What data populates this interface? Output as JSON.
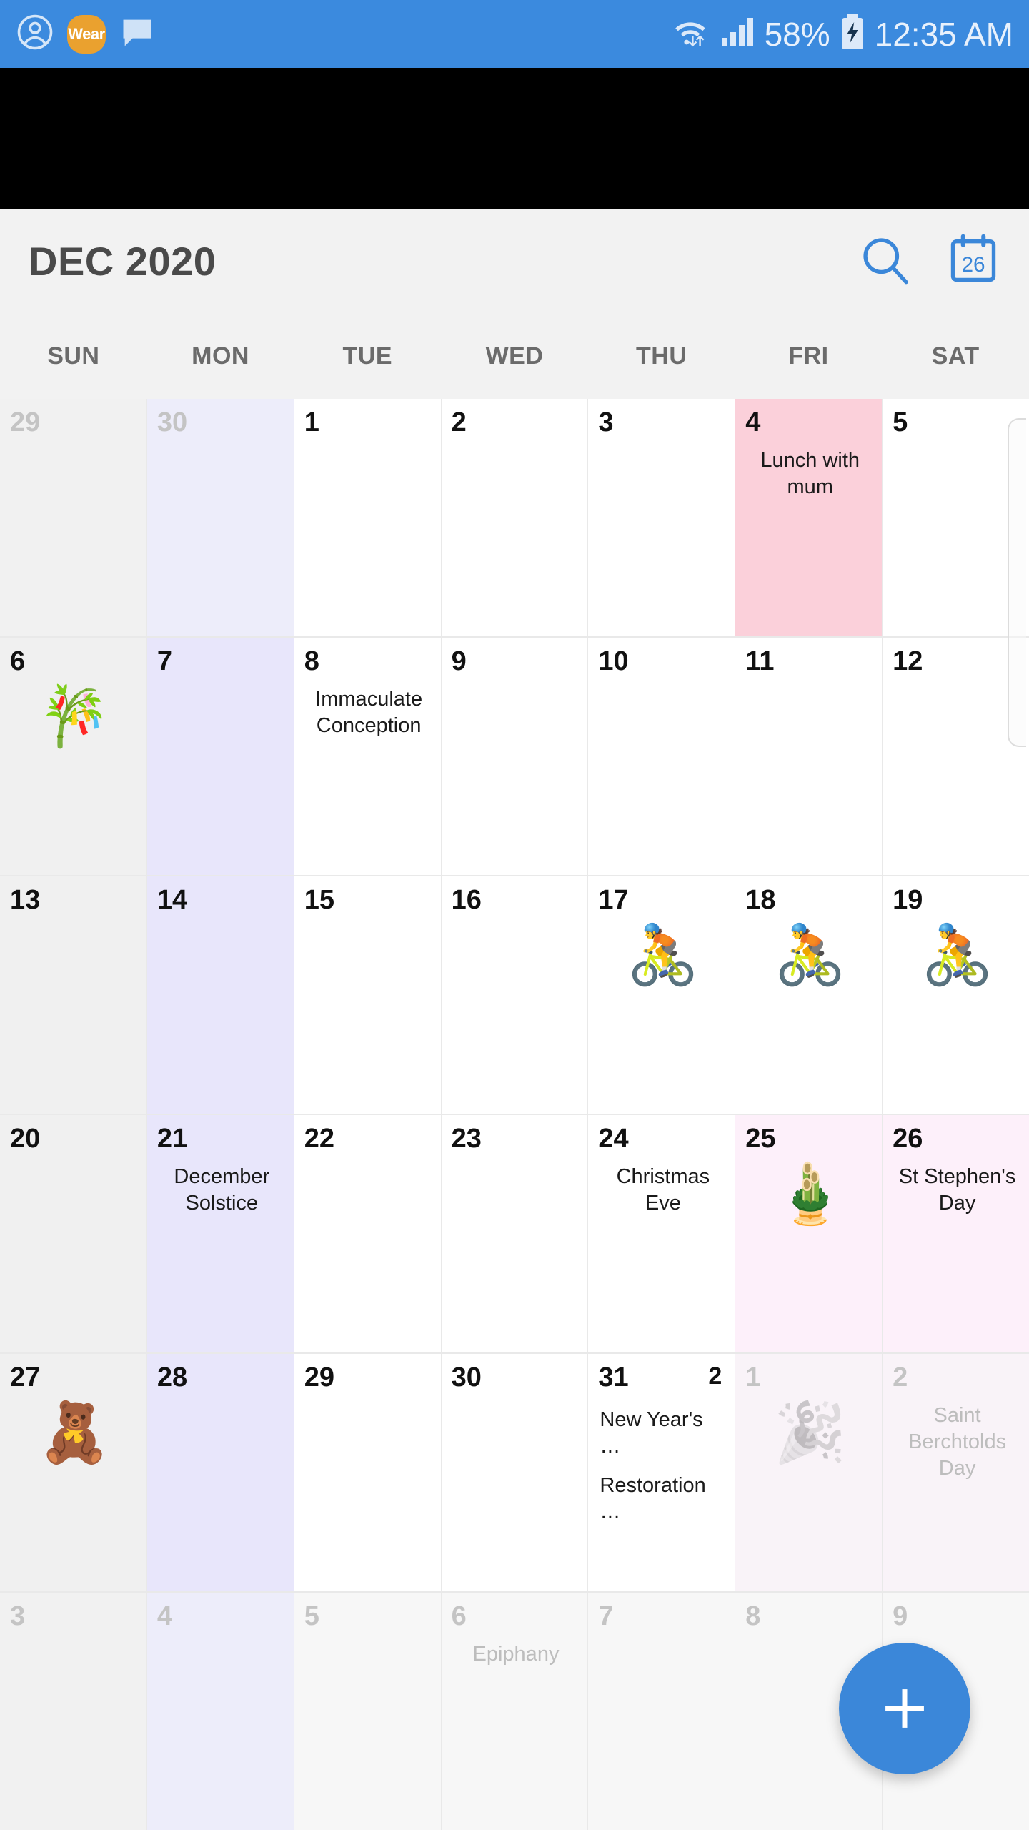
{
  "status_bar": {
    "background": "#3b8ade",
    "left_icons": [
      {
        "name": "account-icon",
        "label": "account"
      },
      {
        "name": "wear-badge-icon",
        "label": "Wear"
      },
      {
        "name": "message-bubble-icon",
        "label": "message"
      }
    ],
    "wear_label": "Wear",
    "wifi_icon": "wifi-icon",
    "signal_icon": "signal-bars-icon",
    "battery_percent": "58%",
    "battery_icon": "battery-charging-icon",
    "time": "12:35 AM"
  },
  "header": {
    "title": "DEC 2020",
    "search_icon": "search-icon",
    "today_icon": "calendar-today-icon",
    "today_icon_number": "26",
    "accent": "#3b87d9"
  },
  "weekdays": [
    "SUN",
    "MON",
    "TUE",
    "WED",
    "THU",
    "FRI",
    "SAT"
  ],
  "colors": {
    "sunday_bg": "#f0f0f0",
    "monday_bg": "#e8e6fb",
    "event_pink": "#fbd0da",
    "holiday_pink": "#fdf0fa",
    "out_of_month_text": "#c4c4c4",
    "fab_blue": "#3b87d9"
  },
  "fab": {
    "label": "+",
    "name": "add-event-button"
  },
  "weeks": [
    [
      {
        "day": "29",
        "out": true,
        "col": "sun"
      },
      {
        "day": "30",
        "out": true,
        "col": "mon"
      },
      {
        "day": "1",
        "out": false,
        "col": ""
      },
      {
        "day": "2",
        "out": false,
        "col": ""
      },
      {
        "day": "3",
        "out": false,
        "col": ""
      },
      {
        "day": "4",
        "out": false,
        "col": "pink",
        "events": [
          "Lunch with mum"
        ]
      },
      {
        "day": "5",
        "out": false,
        "col": ""
      }
    ],
    [
      {
        "day": "6",
        "out": false,
        "col": "sun",
        "emoji": "🎋"
      },
      {
        "day": "7",
        "out": false,
        "col": "mon"
      },
      {
        "day": "8",
        "out": false,
        "col": "",
        "events": [
          "Immaculate Conception"
        ]
      },
      {
        "day": "9",
        "out": false,
        "col": ""
      },
      {
        "day": "10",
        "out": false,
        "col": ""
      },
      {
        "day": "11",
        "out": false,
        "col": ""
      },
      {
        "day": "12",
        "out": false,
        "col": ""
      }
    ],
    [
      {
        "day": "13",
        "out": false,
        "col": "sun"
      },
      {
        "day": "14",
        "out": false,
        "col": "mon"
      },
      {
        "day": "15",
        "out": false,
        "col": ""
      },
      {
        "day": "16",
        "out": false,
        "col": ""
      },
      {
        "day": "17",
        "out": false,
        "col": "",
        "emoji": "🚴"
      },
      {
        "day": "18",
        "out": false,
        "col": "",
        "emoji": "🚴"
      },
      {
        "day": "19",
        "out": false,
        "col": "",
        "emoji": "🚴"
      }
    ],
    [
      {
        "day": "20",
        "out": false,
        "col": "sun"
      },
      {
        "day": "21",
        "out": false,
        "col": "mon",
        "events": [
          "December Solstice"
        ]
      },
      {
        "day": "22",
        "out": false,
        "col": ""
      },
      {
        "day": "23",
        "out": false,
        "col": ""
      },
      {
        "day": "24",
        "out": false,
        "col": "",
        "events": [
          "Christmas Eve"
        ]
      },
      {
        "day": "25",
        "out": false,
        "col": "palepink",
        "emoji": "🎍"
      },
      {
        "day": "26",
        "out": false,
        "col": "palepink",
        "events": [
          "St Stephen's Day"
        ]
      }
    ],
    [
      {
        "day": "27",
        "out": false,
        "col": "sun",
        "emoji": "🧸"
      },
      {
        "day": "28",
        "out": false,
        "col": "mon"
      },
      {
        "day": "29",
        "out": false,
        "col": ""
      },
      {
        "day": "30",
        "out": false,
        "col": ""
      },
      {
        "day": "31",
        "out": false,
        "col": "",
        "badge": "2",
        "events_left": [
          "New Year's …",
          "Restoration…"
        ]
      },
      {
        "day": "1",
        "out": true,
        "col": "palepink",
        "emoji": "🎉"
      },
      {
        "day": "2",
        "out": true,
        "col": "palepink",
        "events": [
          "Saint Berchtolds Day"
        ]
      }
    ],
    [
      {
        "day": "3",
        "out": true,
        "col": "sun"
      },
      {
        "day": "4",
        "out": true,
        "col": "mon"
      },
      {
        "day": "5",
        "out": true,
        "col": ""
      },
      {
        "day": "6",
        "out": true,
        "col": "",
        "events": [
          "Epiphany"
        ]
      },
      {
        "day": "7",
        "out": true,
        "col": ""
      },
      {
        "day": "8",
        "out": true,
        "col": ""
      },
      {
        "day": "9",
        "out": true,
        "col": ""
      }
    ]
  ]
}
